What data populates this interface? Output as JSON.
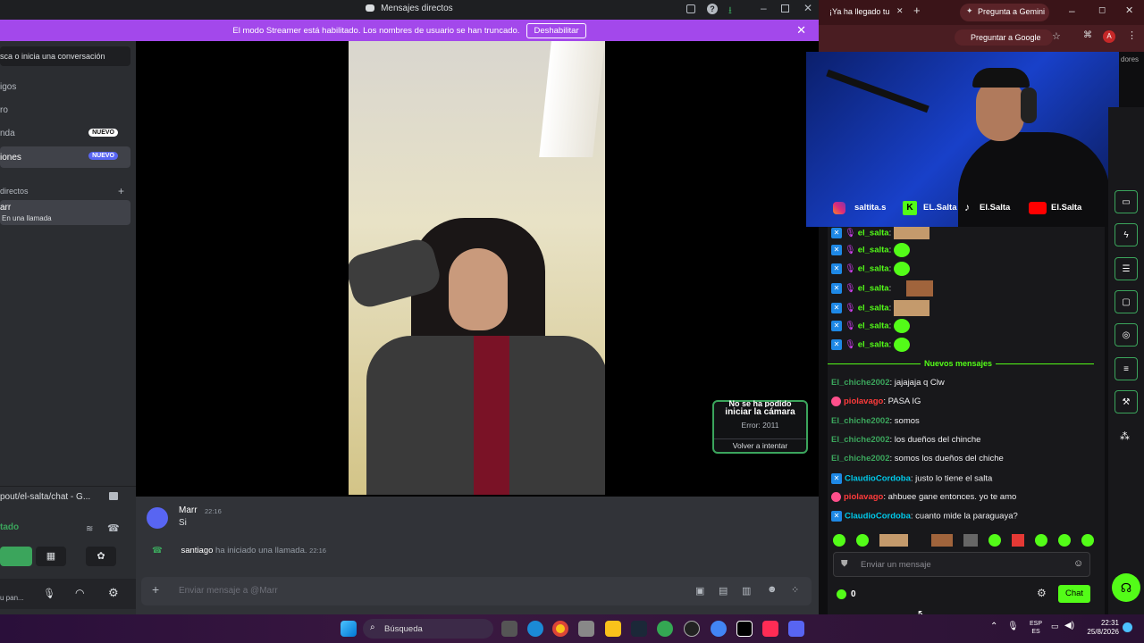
{
  "discord": {
    "title": "Mensajes directos",
    "streamer_text": "El modo Streamer está habilitado. Los nombres de usuario se han truncado.",
    "streamer_button": "Deshabilitar",
    "search_placeholder": "sca o inicia una conversación",
    "nav": [
      {
        "label": "igos"
      },
      {
        "label": "ro"
      },
      {
        "label": "nda",
        "badge": "NUEVO"
      },
      {
        "label": "iones",
        "badge": "NUEVO"
      }
    ],
    "dm_header": "directos",
    "dm_user": "arr",
    "dm_status": "En una llamada",
    "camera_error_title": "iniciar la cámara",
    "camera_error_title_top": "No se ha podido",
    "camera_error_code": "Error: 2011",
    "camera_retry": "Volver a intentar",
    "activity_link": "pout/el-salta/chat - G...",
    "voice_status": "tado",
    "user_panel": "u pan...",
    "messages": [
      {
        "author": "Marr",
        "time": "22:16",
        "text": "Si"
      },
      {
        "author": "santiago",
        "text": "ha iniciado una llamada.",
        "time": "22:16"
      }
    ],
    "input_placeholder": "Enviar mensaje a @Marr"
  },
  "browser": {
    "tab_title": "¡Ya ha llegado tu",
    "gemini_tab": "Pregunta a Gemini",
    "google_btn": "Preguntar a Google",
    "bookmark_text": "dores"
  },
  "overlay": {
    "socials": [
      {
        "handle": "saltita.s"
      },
      {
        "handle": "EL.Salta"
      },
      {
        "handle": "El.Salta"
      },
      {
        "handle": "El.Salta"
      }
    ]
  },
  "twitch_chat": {
    "top_messages": [
      {
        "user": "el_salta"
      },
      {
        "user": "el_salta"
      },
      {
        "user": "el_salta"
      },
      {
        "user": "el_salta"
      },
      {
        "user": "el_salta"
      },
      {
        "user": "el_salta"
      },
      {
        "user": "el_salta"
      }
    ],
    "divider": "Nuevos mensajes",
    "messages": [
      {
        "user": "El_chiche2002",
        "text": "jajajaja q Clw",
        "color": "#3ba55c"
      },
      {
        "user": "piolavago",
        "text": "PASA IG",
        "color": "#ff3b3b"
      },
      {
        "user": "El_chiche2002",
        "text": "somos",
        "color": "#3ba55c"
      },
      {
        "user": "El_chiche2002",
        "text": "los dueños del chinche",
        "color": "#3ba55c"
      },
      {
        "user": "El_chiche2002",
        "text": "somos los dueños del chiche",
        "color": "#3ba55c"
      },
      {
        "user": "ClaudioCordoba",
        "text": "justo lo tiene el salta",
        "color": "#00c8e8"
      },
      {
        "user": "piolavago",
        "text": "ahbuee gane entonces. yo te amo",
        "color": "#ff3b3b"
      },
      {
        "user": "ClaudioCordoba",
        "text": "cuanto mide la paraguaya?",
        "color": "#00c8e8"
      }
    ],
    "input_placeholder": "Enviar un mensaje",
    "points": "0",
    "chat_button": "Chat"
  },
  "taskbar": {
    "search": "Búsqueda",
    "lang_top": "ESP",
    "lang_bottom": "ES",
    "time": "22:31",
    "date": "25/8/2026"
  }
}
